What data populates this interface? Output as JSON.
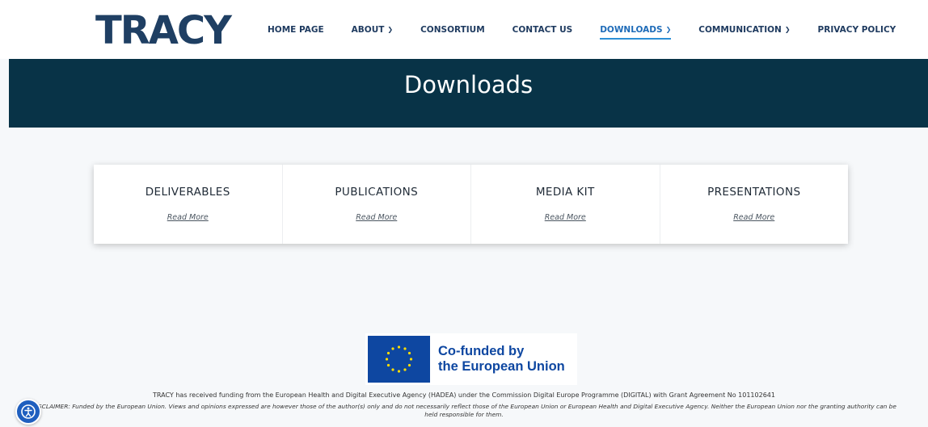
{
  "header": {
    "logo_text": "TRACY",
    "nav": [
      {
        "label": "HOME PAGE",
        "has_dropdown": false,
        "active": false
      },
      {
        "label": "ABOUT",
        "has_dropdown": true,
        "active": false
      },
      {
        "label": "CONSORTIUM",
        "has_dropdown": false,
        "active": false
      },
      {
        "label": "CONTACT US",
        "has_dropdown": false,
        "active": false
      },
      {
        "label": "DOWNLOADS",
        "has_dropdown": true,
        "active": true
      },
      {
        "label": "COMMUNICATION",
        "has_dropdown": true,
        "active": false
      },
      {
        "label": "PRIVACY POLICY",
        "has_dropdown": false,
        "active": false
      }
    ]
  },
  "banner": {
    "title": "Downloads"
  },
  "cards": [
    {
      "title": "DELIVERABLES",
      "link": "Read More"
    },
    {
      "title": "PUBLICATIONS",
      "link": "Read More"
    },
    {
      "title": "MEDIA KIT",
      "link": "Read More"
    },
    {
      "title": "PRESENTATIONS",
      "link": "Read More"
    }
  ],
  "eu_badge": {
    "line1": "Co-funded by",
    "line2": "the European Union"
  },
  "footer": {
    "funding": "TRACY has received funding from the European Health and Digital Executive Agency (HADEA) under the Commission Digital Europe Programme (DIGITAL) with Grant Agreement No 101102641",
    "disclaimer": "DISCLAIMER: Funded by the European Union. Views and opinions expressed are however those of the author(s) only and do not necessarily reflect those of the European Union or European Health and Digital Executive Agency. Neither the European Union nor the granting authority can be",
    "disclaimer_line2": "held responsible for them."
  },
  "colors": {
    "brand": "#1f3f63",
    "banner": "#083347",
    "accent": "#2c8fd6",
    "eu_blue": "#0e47a1"
  },
  "icons": {
    "accessibility": "accessibility-icon",
    "chevron": "chevron-down-icon",
    "eu_flag": "eu-flag-icon"
  }
}
